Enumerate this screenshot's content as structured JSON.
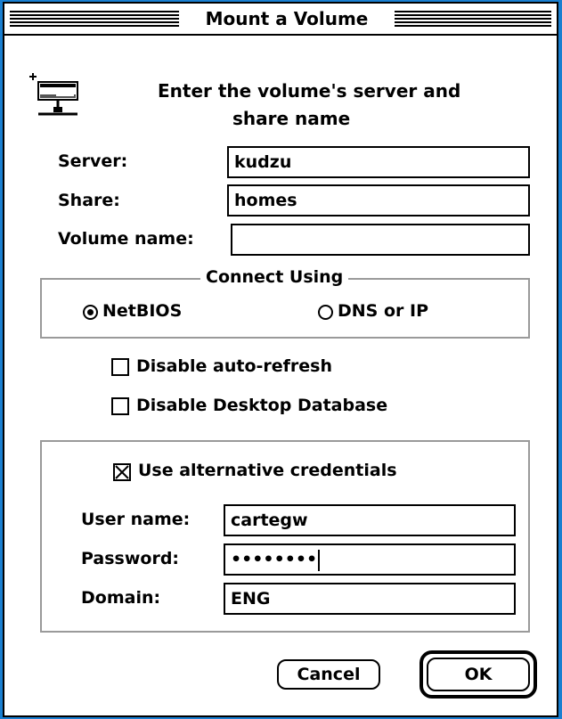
{
  "dialog": {
    "title": "Mount a Volume",
    "prompt_line1": "Enter the volume's server and",
    "prompt_line2": "share name",
    "icon": "network-server-icon"
  },
  "fields": {
    "server_label": "Server:",
    "server_value": "kudzu",
    "share_label": "Share:",
    "share_value": "homes",
    "volume_label": "Volume name:",
    "volume_value": ""
  },
  "connect": {
    "group_label": "Connect Using",
    "netbios_label": "NetBIOS",
    "netbios_selected": true,
    "dns_label": "DNS or IP",
    "dns_selected": false
  },
  "options": {
    "auto_refresh_label": "Disable auto-refresh",
    "auto_refresh_checked": false,
    "desktop_db_label": "Disable Desktop Database",
    "desktop_db_checked": false
  },
  "credentials": {
    "use_alt_label": "Use alternative credentials",
    "use_alt_checked": true,
    "user_label": "User name:",
    "user_value": "cartegw",
    "password_label": "Password:",
    "password_masked": "••••••••",
    "domain_label": "Domain:",
    "domain_value": "ENG"
  },
  "buttons": {
    "cancel_label": "Cancel",
    "ok_label": "OK"
  },
  "colors": {
    "desktop": "#1a7fd0",
    "group_border": "#9a9a9a"
  }
}
